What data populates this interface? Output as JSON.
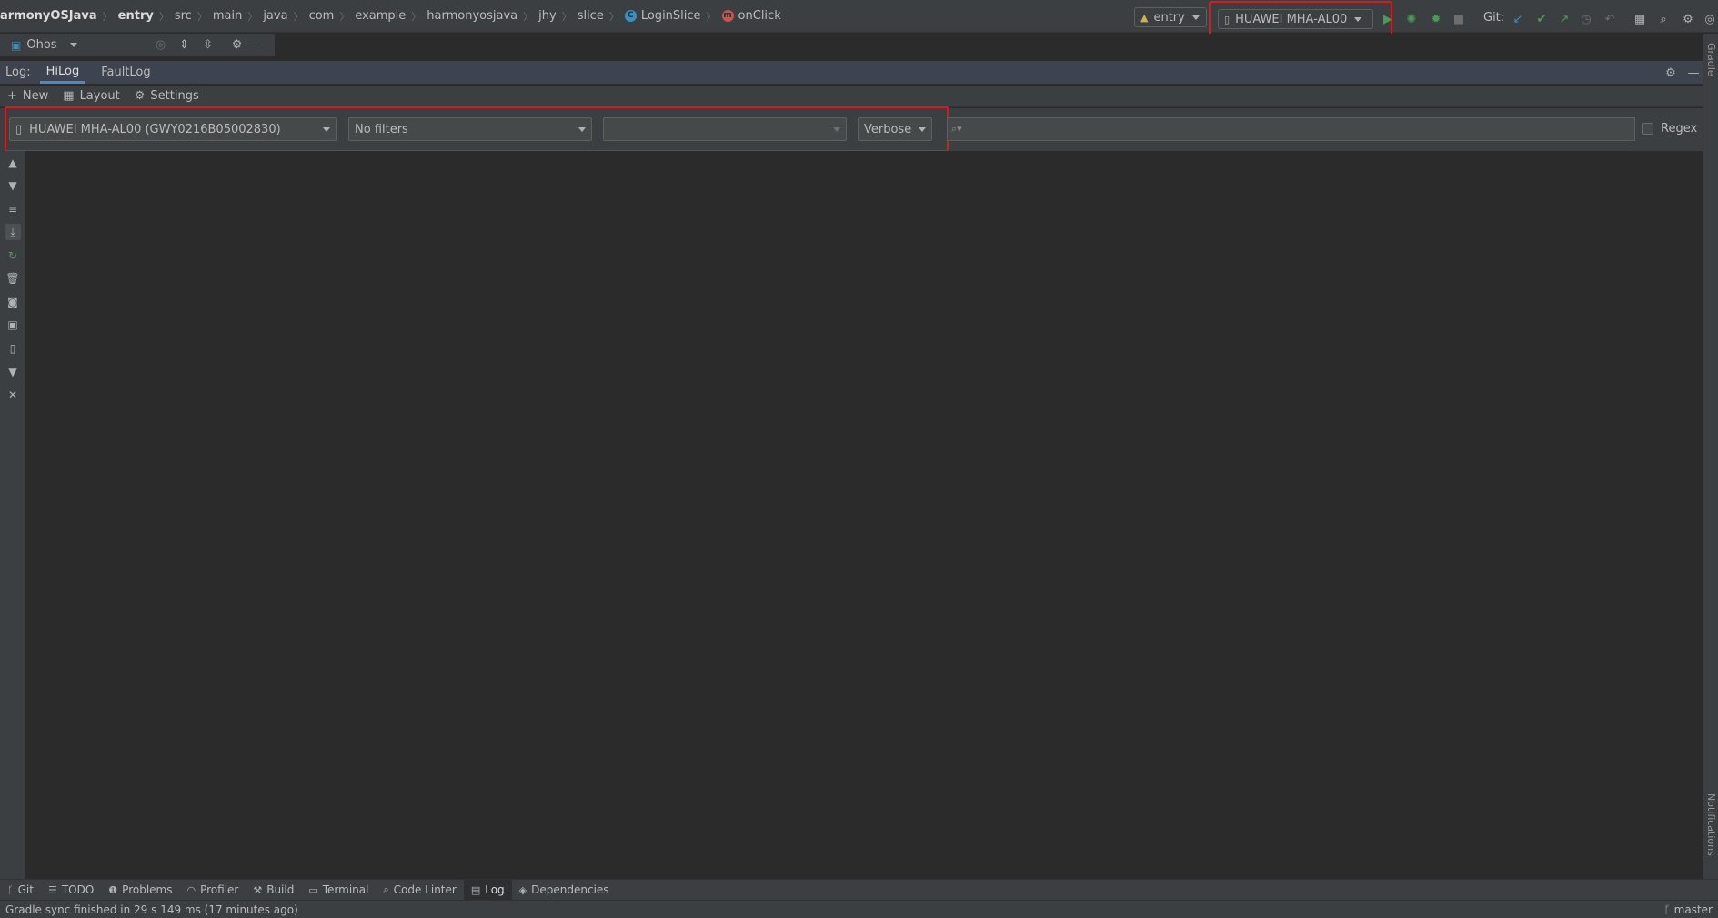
{
  "breadcrumbs": [
    {
      "label": "armonyOSJava",
      "bold": true
    },
    {
      "label": "entry",
      "bold": true
    },
    {
      "label": "src"
    },
    {
      "label": "main"
    },
    {
      "label": "java"
    },
    {
      "label": "com"
    },
    {
      "label": "example"
    },
    {
      "label": "harmonyosjava"
    },
    {
      "label": "jhy"
    },
    {
      "label": "slice"
    },
    {
      "label": "LoginSlice",
      "icon": "class-icon",
      "icon_letter": "C",
      "icon_color": "#3592c4"
    },
    {
      "label": "onClick",
      "icon": "method-icon",
      "icon_letter": "m",
      "icon_color": "#c75450"
    }
  ],
  "toolbar": {
    "run_config": "entry",
    "device": "HUAWEI MHA-AL00",
    "git_label": "Git:"
  },
  "tool_window": {
    "title": "Ohos"
  },
  "log": {
    "label": "Log:",
    "tabs": [
      {
        "label": "HiLog",
        "selected": true
      },
      {
        "label": "FaultLog",
        "selected": false
      }
    ],
    "actions": {
      "new": "New",
      "layout": "Layout",
      "settings": "Settings"
    },
    "filters": {
      "device": "HUAWEI MHA-AL00 (GWY0216B05002830)",
      "filter": "No filters",
      "process": "",
      "level": "Verbose",
      "search_placeholder": "",
      "regex_label": "Regex"
    }
  },
  "right_strip": {
    "top": "Gradle",
    "bottom": "Notifications"
  },
  "bottom_tabs": [
    {
      "label": "Git",
      "icon": "branch-icon"
    },
    {
      "label": "TODO",
      "icon": "list-icon"
    },
    {
      "label": "Problems",
      "icon": "problems-icon"
    },
    {
      "label": "Profiler",
      "icon": "gauge-icon"
    },
    {
      "label": "Build",
      "icon": "hammer-icon"
    },
    {
      "label": "Terminal",
      "icon": "terminal-icon"
    },
    {
      "label": "Code Linter",
      "icon": "linter-icon"
    },
    {
      "label": "Log",
      "icon": "log-icon",
      "selected": true
    },
    {
      "label": "Dependencies",
      "icon": "layers-icon"
    }
  ],
  "status": {
    "message": "Gradle sync finished in 29 s 149 ms (17 minutes ago)",
    "branch": "master"
  },
  "colors": {
    "highlight": "#e0161b",
    "accent": "#4a88c7",
    "run_green": "#499c54"
  }
}
